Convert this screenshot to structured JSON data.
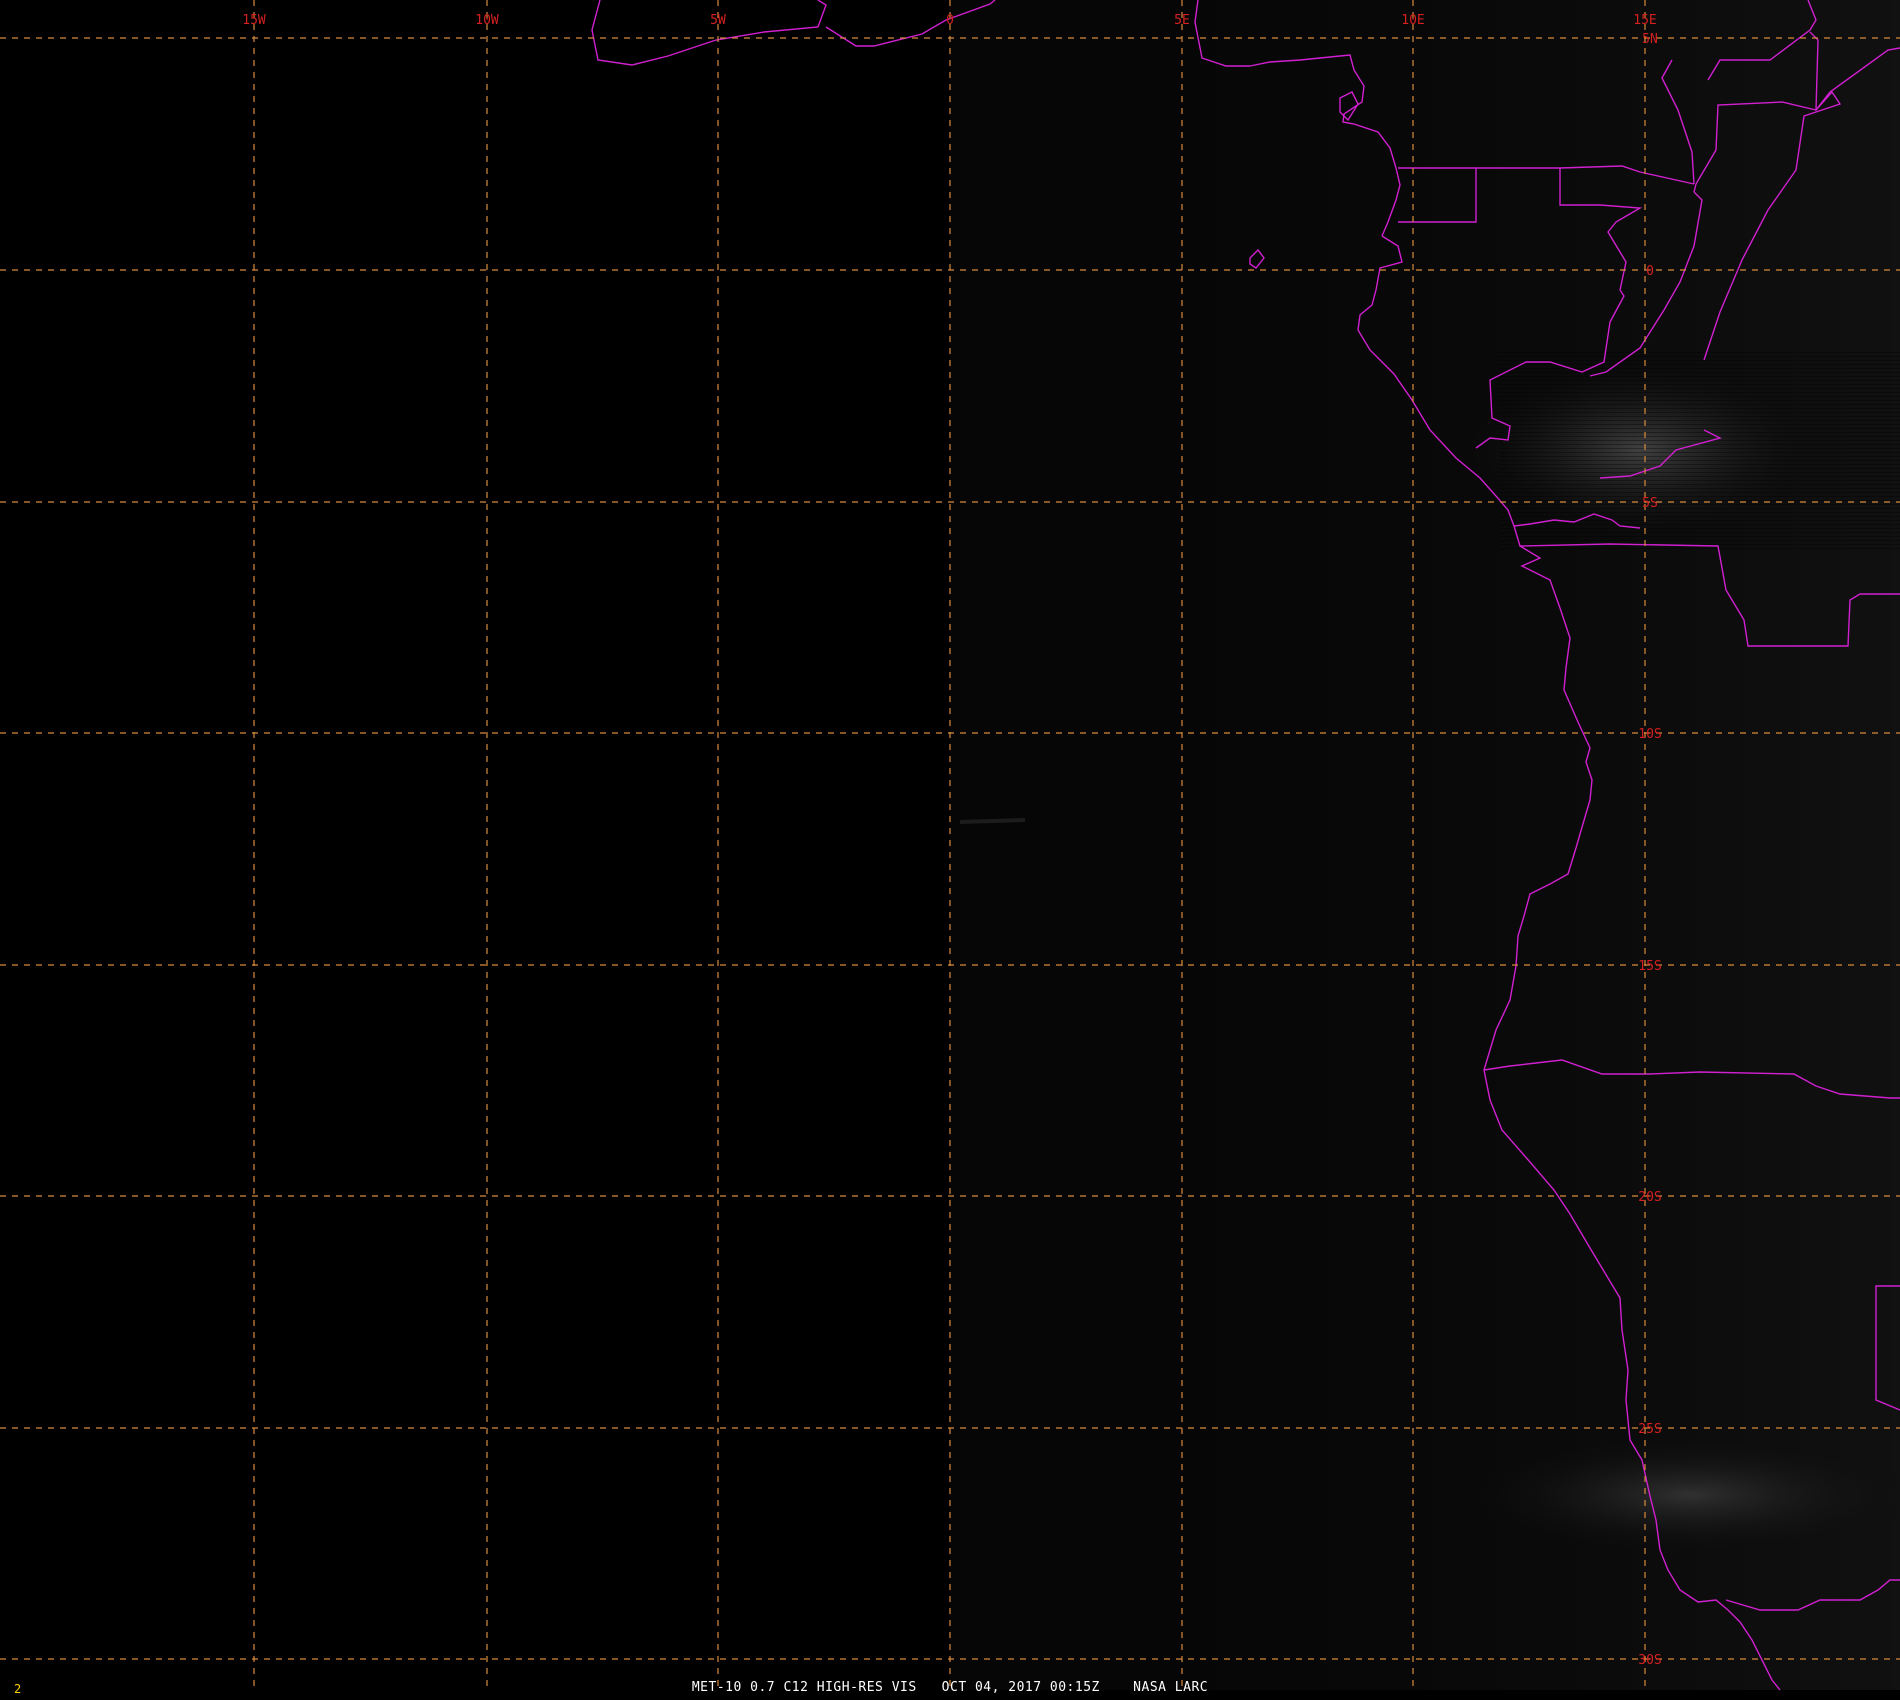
{
  "map": {
    "lon_labels": [
      "15W",
      "10W",
      "5W",
      "0",
      "5E",
      "10E",
      "15E"
    ],
    "lat_labels": [
      "5N",
      "0",
      "5S",
      "10S",
      "15S",
      "20S",
      "25S",
      "30S"
    ],
    "colors": {
      "grid": "#d88a3c",
      "grid_label": "#d42020",
      "boundary": "#d020d0",
      "caption": "#ffffff",
      "frame_number": "#ffd000"
    }
  },
  "caption": {
    "text": "MET-10 0.7 C12 HIGH-RES VIS   OCT 04, 2017 00:15Z    NASA LARC"
  },
  "frame_number": "2"
}
